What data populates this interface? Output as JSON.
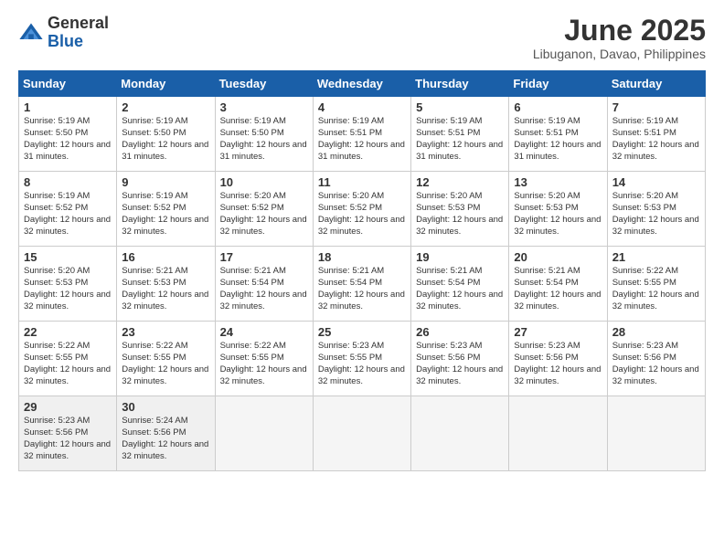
{
  "logo": {
    "general": "General",
    "blue": "Blue"
  },
  "title": "June 2025",
  "location": "Libuganon, Davao, Philippines",
  "days_of_week": [
    "Sunday",
    "Monday",
    "Tuesday",
    "Wednesday",
    "Thursday",
    "Friday",
    "Saturday"
  ],
  "weeks": [
    [
      {
        "day": "1",
        "sunrise": "5:19 AM",
        "sunset": "5:50 PM",
        "daylight": "12 hours and 31 minutes."
      },
      {
        "day": "2",
        "sunrise": "5:19 AM",
        "sunset": "5:50 PM",
        "daylight": "12 hours and 31 minutes."
      },
      {
        "day": "3",
        "sunrise": "5:19 AM",
        "sunset": "5:50 PM",
        "daylight": "12 hours and 31 minutes."
      },
      {
        "day": "4",
        "sunrise": "5:19 AM",
        "sunset": "5:51 PM",
        "daylight": "12 hours and 31 minutes."
      },
      {
        "day": "5",
        "sunrise": "5:19 AM",
        "sunset": "5:51 PM",
        "daylight": "12 hours and 31 minutes."
      },
      {
        "day": "6",
        "sunrise": "5:19 AM",
        "sunset": "5:51 PM",
        "daylight": "12 hours and 31 minutes."
      },
      {
        "day": "7",
        "sunrise": "5:19 AM",
        "sunset": "5:51 PM",
        "daylight": "12 hours and 32 minutes."
      }
    ],
    [
      {
        "day": "8",
        "sunrise": "5:19 AM",
        "sunset": "5:52 PM",
        "daylight": "12 hours and 32 minutes."
      },
      {
        "day": "9",
        "sunrise": "5:19 AM",
        "sunset": "5:52 PM",
        "daylight": "12 hours and 32 minutes."
      },
      {
        "day": "10",
        "sunrise": "5:20 AM",
        "sunset": "5:52 PM",
        "daylight": "12 hours and 32 minutes."
      },
      {
        "day": "11",
        "sunrise": "5:20 AM",
        "sunset": "5:52 PM",
        "daylight": "12 hours and 32 minutes."
      },
      {
        "day": "12",
        "sunrise": "5:20 AM",
        "sunset": "5:53 PM",
        "daylight": "12 hours and 32 minutes."
      },
      {
        "day": "13",
        "sunrise": "5:20 AM",
        "sunset": "5:53 PM",
        "daylight": "12 hours and 32 minutes."
      },
      {
        "day": "14",
        "sunrise": "5:20 AM",
        "sunset": "5:53 PM",
        "daylight": "12 hours and 32 minutes."
      }
    ],
    [
      {
        "day": "15",
        "sunrise": "5:20 AM",
        "sunset": "5:53 PM",
        "daylight": "12 hours and 32 minutes."
      },
      {
        "day": "16",
        "sunrise": "5:21 AM",
        "sunset": "5:53 PM",
        "daylight": "12 hours and 32 minutes."
      },
      {
        "day": "17",
        "sunrise": "5:21 AM",
        "sunset": "5:54 PM",
        "daylight": "12 hours and 32 minutes."
      },
      {
        "day": "18",
        "sunrise": "5:21 AM",
        "sunset": "5:54 PM",
        "daylight": "12 hours and 32 minutes."
      },
      {
        "day": "19",
        "sunrise": "5:21 AM",
        "sunset": "5:54 PM",
        "daylight": "12 hours and 32 minutes."
      },
      {
        "day": "20",
        "sunrise": "5:21 AM",
        "sunset": "5:54 PM",
        "daylight": "12 hours and 32 minutes."
      },
      {
        "day": "21",
        "sunrise": "5:22 AM",
        "sunset": "5:55 PM",
        "daylight": "12 hours and 32 minutes."
      }
    ],
    [
      {
        "day": "22",
        "sunrise": "5:22 AM",
        "sunset": "5:55 PM",
        "daylight": "12 hours and 32 minutes."
      },
      {
        "day": "23",
        "sunrise": "5:22 AM",
        "sunset": "5:55 PM",
        "daylight": "12 hours and 32 minutes."
      },
      {
        "day": "24",
        "sunrise": "5:22 AM",
        "sunset": "5:55 PM",
        "daylight": "12 hours and 32 minutes."
      },
      {
        "day": "25",
        "sunrise": "5:23 AM",
        "sunset": "5:55 PM",
        "daylight": "12 hours and 32 minutes."
      },
      {
        "day": "26",
        "sunrise": "5:23 AM",
        "sunset": "5:56 PM",
        "daylight": "12 hours and 32 minutes."
      },
      {
        "day": "27",
        "sunrise": "5:23 AM",
        "sunset": "5:56 PM",
        "daylight": "12 hours and 32 minutes."
      },
      {
        "day": "28",
        "sunrise": "5:23 AM",
        "sunset": "5:56 PM",
        "daylight": "12 hours and 32 minutes."
      }
    ],
    [
      {
        "day": "29",
        "sunrise": "5:23 AM",
        "sunset": "5:56 PM",
        "daylight": "12 hours and 32 minutes."
      },
      {
        "day": "30",
        "sunrise": "5:24 AM",
        "sunset": "5:56 PM",
        "daylight": "12 hours and 32 minutes."
      },
      null,
      null,
      null,
      null,
      null
    ]
  ],
  "labels": {
    "sunrise": "Sunrise:",
    "sunset": "Sunset:",
    "daylight": "Daylight:"
  }
}
